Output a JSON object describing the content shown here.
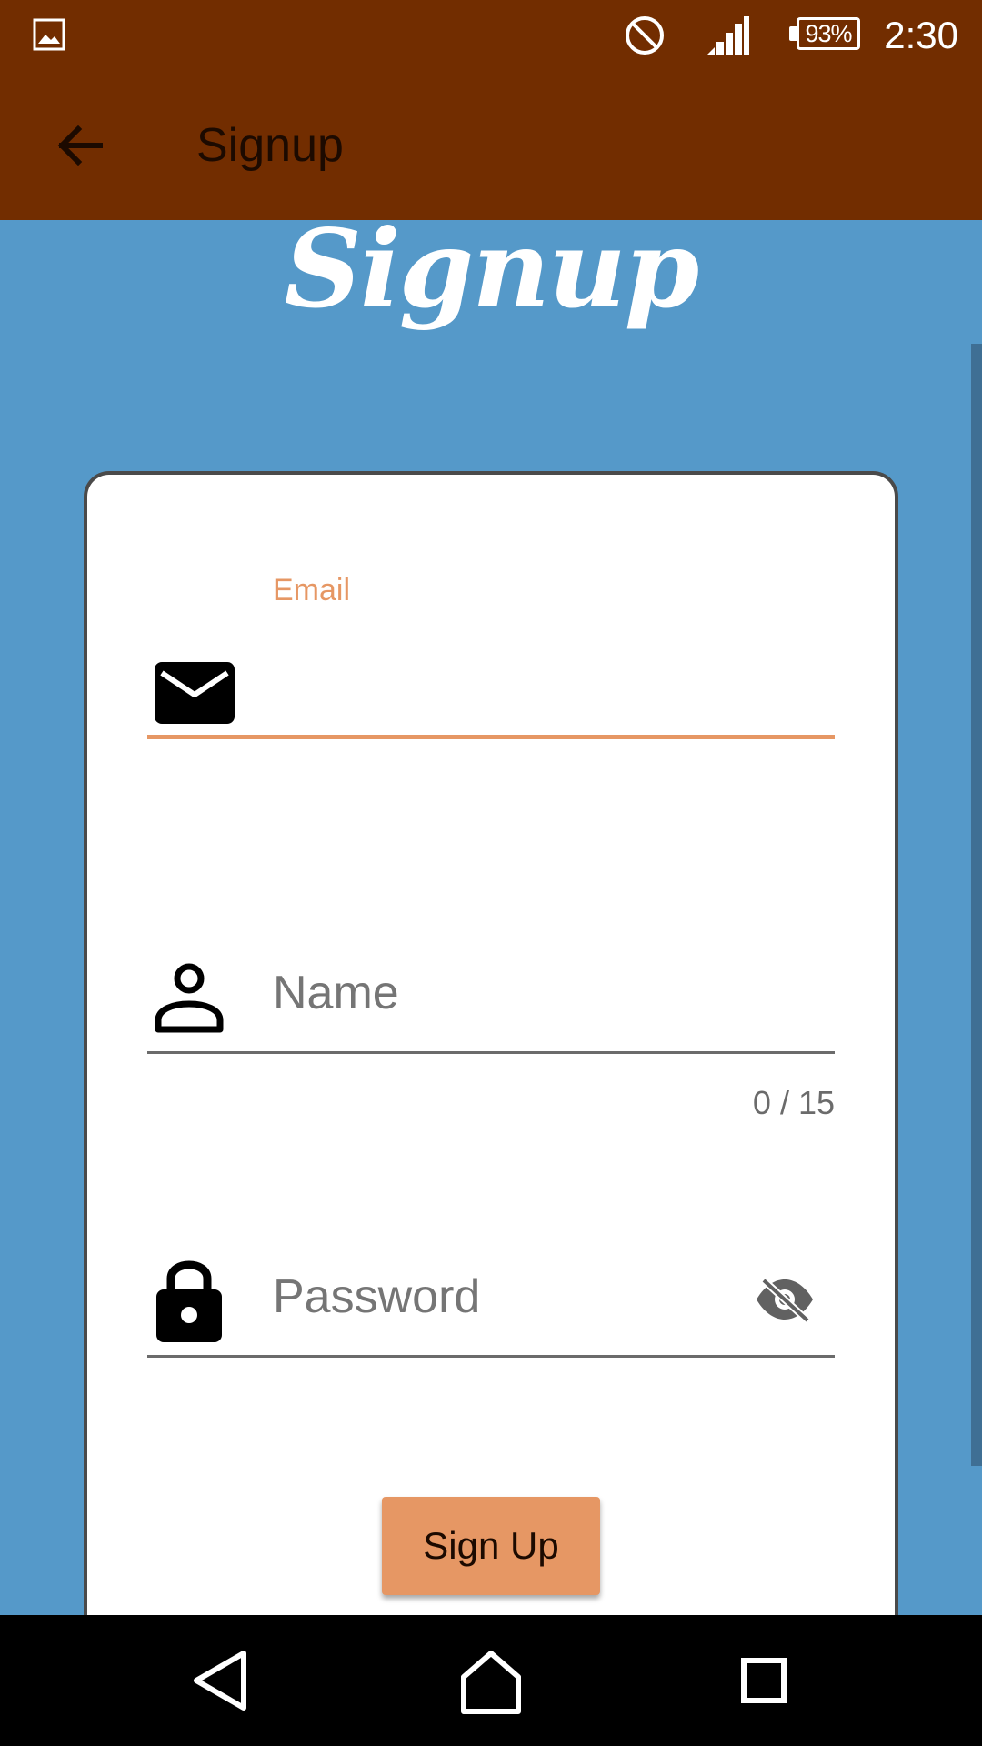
{
  "status_bar": {
    "battery_percent": "93%",
    "time": "2:30",
    "icons": [
      "gallery-icon",
      "do-not-disturb-icon",
      "signal-icon",
      "battery-icon"
    ]
  },
  "app_bar": {
    "title": "Signup",
    "back_icon": "arrow-back-icon"
  },
  "hero": {
    "title": "Signup"
  },
  "form": {
    "email": {
      "label": "Email",
      "value": "",
      "icon": "mail-icon"
    },
    "name": {
      "placeholder": "Name",
      "value": "",
      "counter": "0 / 15",
      "icon": "person-icon"
    },
    "password": {
      "placeholder": "Password",
      "value": "",
      "icon": "lock-icon",
      "toggle_icon": "visibility-off-icon"
    },
    "submit_label": "Sign Up"
  },
  "nav_bar": {
    "icons": [
      "nav-back-icon",
      "nav-home-icon",
      "nav-recents-icon"
    ]
  },
  "colors": {
    "bar": "#722d00",
    "background": "#5599c9",
    "accent": "#e69764",
    "card": "#ffffff"
  }
}
